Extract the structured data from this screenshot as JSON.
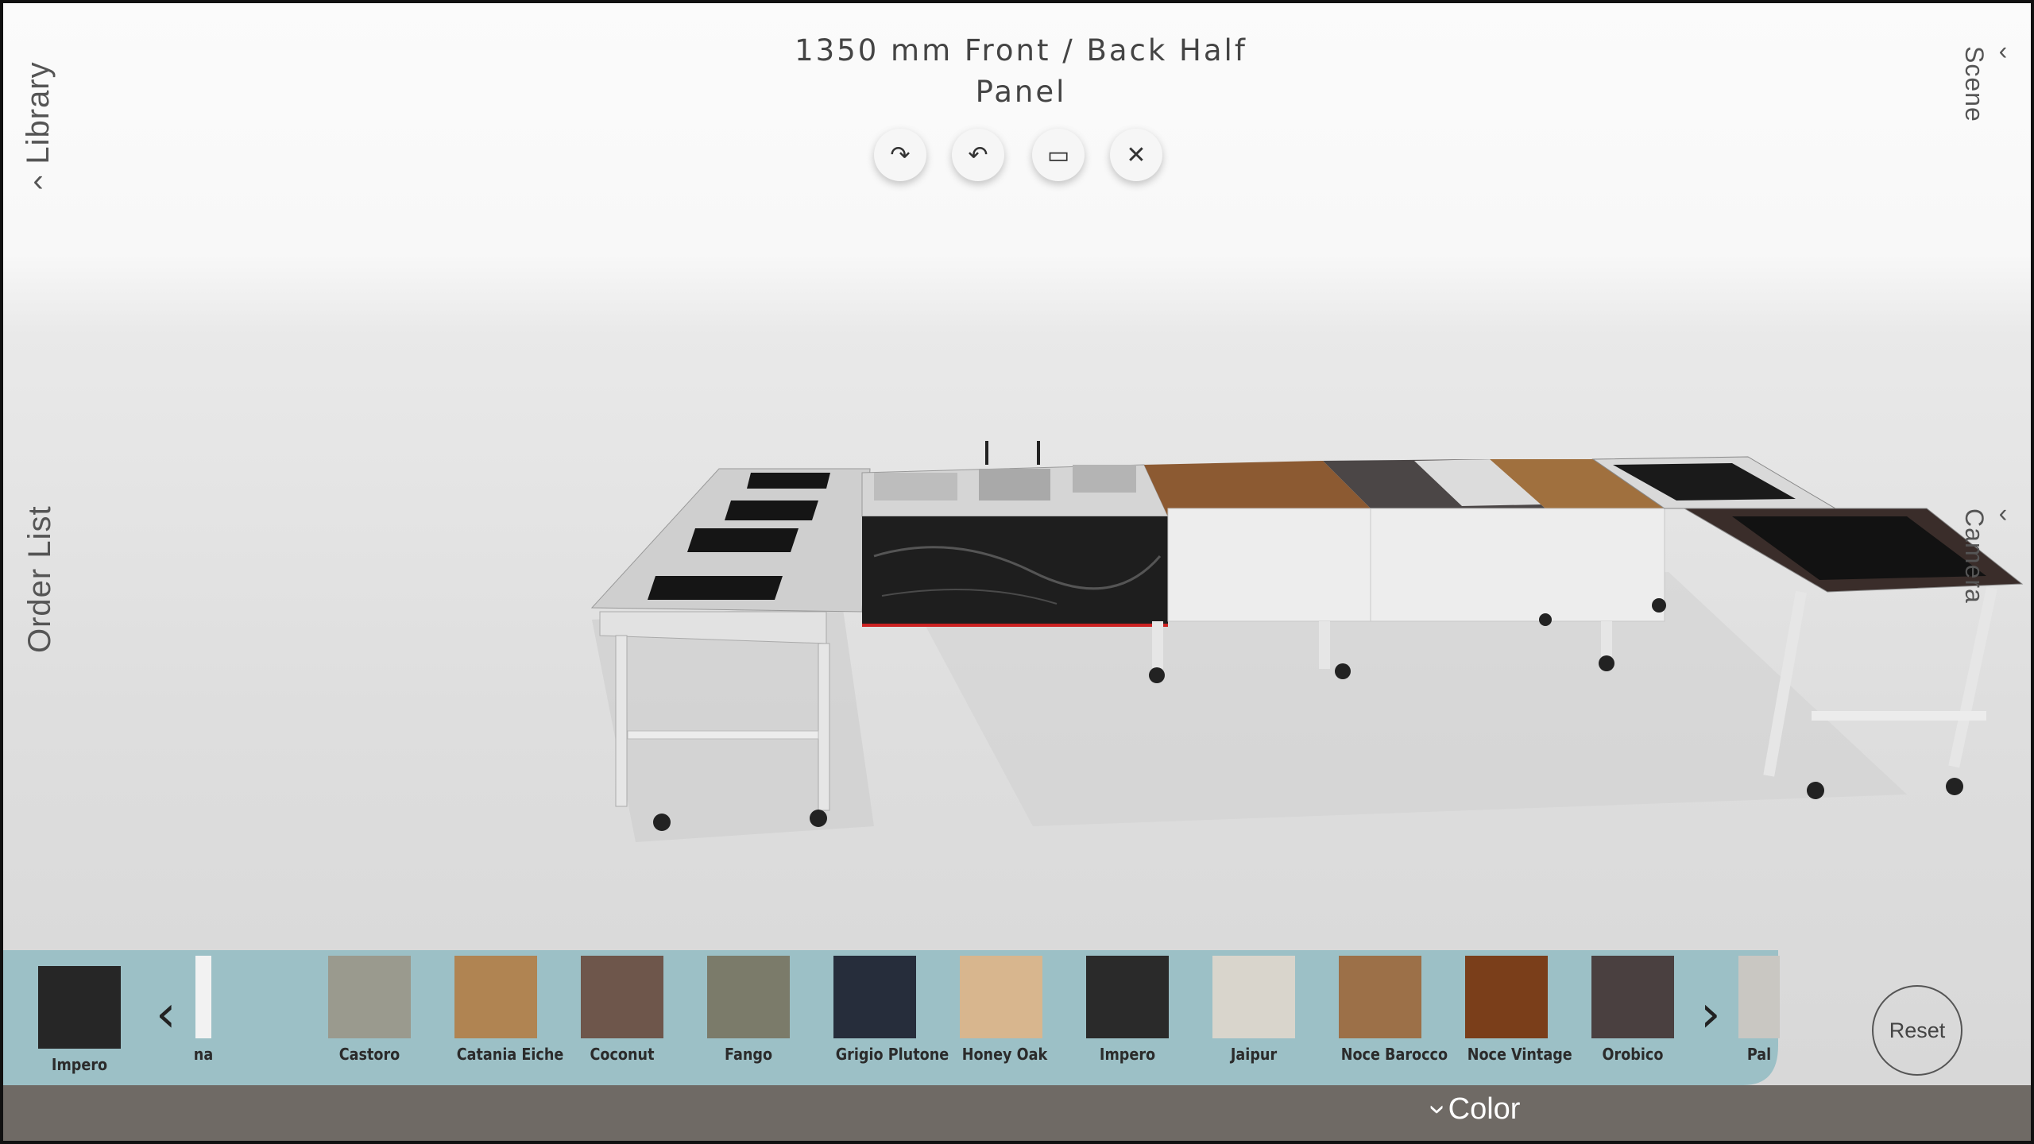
{
  "title": "1350 mm Front / Back Half Panel",
  "left_tabs": {
    "library": "Library",
    "library_icon": "chevron-left",
    "order_list": "Order List"
  },
  "right_tabs": {
    "scene": "Scene",
    "camera": "Camera",
    "icon": "chevron-left"
  },
  "toolbar": [
    {
      "name": "rotate-right",
      "glyph": "↷"
    },
    {
      "name": "rotate-left",
      "glyph": "↶"
    },
    {
      "name": "measure",
      "glyph": "▭"
    },
    {
      "name": "close",
      "glyph": "✕"
    }
  ],
  "color_panel": {
    "toggle_label": "Color",
    "toggle_icon": "chevron-down",
    "reset_label": "Reset",
    "selected": {
      "label": "Impero",
      "color": "#262626"
    },
    "prev_icon": "‹",
    "next_icon": "›",
    "swatches": [
      {
        "label": "na",
        "color": "#f2f2f2"
      },
      {
        "label": "Castoro",
        "color": "#9a9a8e"
      },
      {
        "label": "Catania Eiche",
        "color": "#b08452"
      },
      {
        "label": "Coconut",
        "color": "#6e564b"
      },
      {
        "label": "Fango",
        "color": "#7b7b6a"
      },
      {
        "label": "Grigio Plutone",
        "color": "#262d3b"
      },
      {
        "label": "Honey Oak",
        "color": "#d8b68e"
      },
      {
        "label": "Impero",
        "color": "#2a2a2a"
      },
      {
        "label": "Jaipur",
        "color": "#d9d5cc"
      },
      {
        "label": "Noce Barocco",
        "color": "#9c7048"
      },
      {
        "label": "Noce Vintage",
        "color": "#7a3e1a"
      },
      {
        "label": "Orobico",
        "color": "#4a4040"
      },
      {
        "label": "Pal",
        "color": "#c9c7c2"
      }
    ]
  },
  "colors": {
    "panel": "#9cc0c6",
    "bottom_bar": "#6f6a65"
  }
}
